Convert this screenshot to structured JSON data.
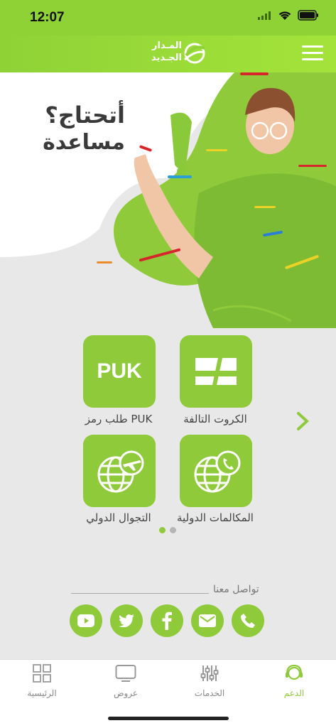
{
  "status_bar": {
    "time": "12:07"
  },
  "header": {
    "logo_line1": "المـدار",
    "logo_line2": "الجـديد"
  },
  "hero": {
    "line1": "أتحتاج؟",
    "line2": "مساعدة"
  },
  "services": [
    {
      "label": "الكروت التالفة",
      "icon": "damaged-card-icon"
    },
    {
      "label": "طلب رمز PUK",
      "icon": "puk-text-icon",
      "icon_text": "PUK"
    },
    {
      "label": "المكالمات الدولية",
      "icon": "globe-phone-icon"
    },
    {
      "label": "التجوال الدولي",
      "icon": "globe-plane-icon"
    }
  ],
  "pagination": {
    "active_page": 1,
    "total_pages": 2
  },
  "contact": {
    "title": "تواصل معنا",
    "channels": [
      "phone-icon",
      "email-icon",
      "facebook-icon",
      "twitter-icon",
      "youtube-icon"
    ]
  },
  "tabbar": {
    "tabs": [
      {
        "label": "الدعم",
        "icon": "support-icon",
        "active": true
      },
      {
        "label": "الخدمات",
        "icon": "sliders-icon",
        "active": false
      },
      {
        "label": "عروض",
        "icon": "tv-icon",
        "active": false
      },
      {
        "label": "الرئيسية",
        "icon": "grid-icon",
        "active": false
      }
    ]
  },
  "colors": {
    "brand_green": "#8fca3a",
    "header_green": "#8fd236",
    "background": "#e8e8e8"
  }
}
